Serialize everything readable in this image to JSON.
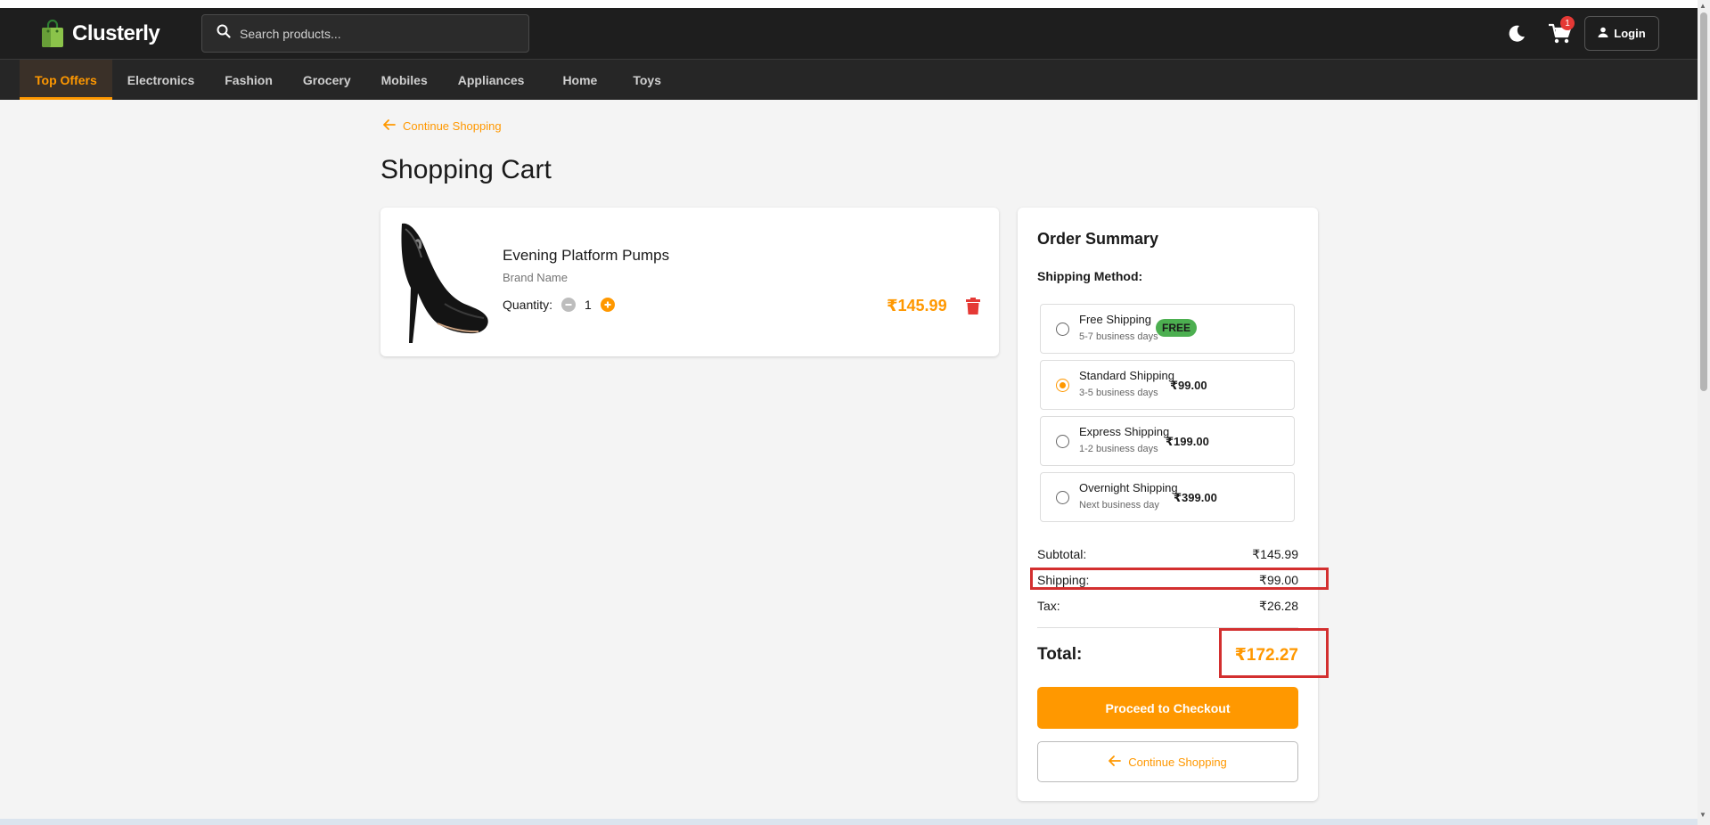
{
  "header": {
    "logo_text": "Clusterly",
    "search_placeholder": "Search products...",
    "cart_count": "1",
    "login_label": "Login"
  },
  "nav": {
    "items": [
      "Top Offers",
      "Electronics",
      "Fashion",
      "Grocery",
      "Mobiles",
      "Appliances",
      "Home",
      "Toys"
    ],
    "active": "Top Offers"
  },
  "page": {
    "back_link": "Continue Shopping",
    "title": "Shopping Cart"
  },
  "cart_item": {
    "name": "Evening Platform Pumps",
    "brand": "Brand Name",
    "quantity_label": "Quantity:",
    "quantity": "1",
    "price": "₹145.99"
  },
  "summary": {
    "title": "Order Summary",
    "shipping_method_label": "Shipping Method:",
    "options": [
      {
        "name": "Free Shipping",
        "days": "5-7 business days",
        "price": "",
        "badge": "FREE",
        "selected": false
      },
      {
        "name": "Standard Shipping",
        "days": "3-5 business days",
        "price": "₹99.00",
        "selected": true
      },
      {
        "name": "Express Shipping",
        "days": "1-2 business days",
        "price": "₹199.00",
        "selected": false
      },
      {
        "name": "Overnight Shipping",
        "days": "Next business day",
        "price": "₹399.00",
        "selected": false
      }
    ],
    "subtotal_label": "Subtotal:",
    "subtotal": "₹145.99",
    "shipping_label": "Shipping:",
    "shipping": "₹99.00",
    "tax_label": "Tax:",
    "tax": "₹26.28",
    "total_label": "Total:",
    "total": "₹172.27",
    "checkout_label": "Proceed to Checkout",
    "continue_label": "Continue Shopping"
  },
  "colors": {
    "accent": "#ff9800",
    "header_bg": "#1e1e1e",
    "free_badge": "#4caf50",
    "delete": "#e53935",
    "highlight": "#d32f2f"
  },
  "icons": [
    "shopping-bag-logo-icon",
    "search-icon",
    "moon-icon",
    "cart-icon",
    "user-icon",
    "arrow-left-icon",
    "minus-icon",
    "plus-icon",
    "trash-icon"
  ]
}
